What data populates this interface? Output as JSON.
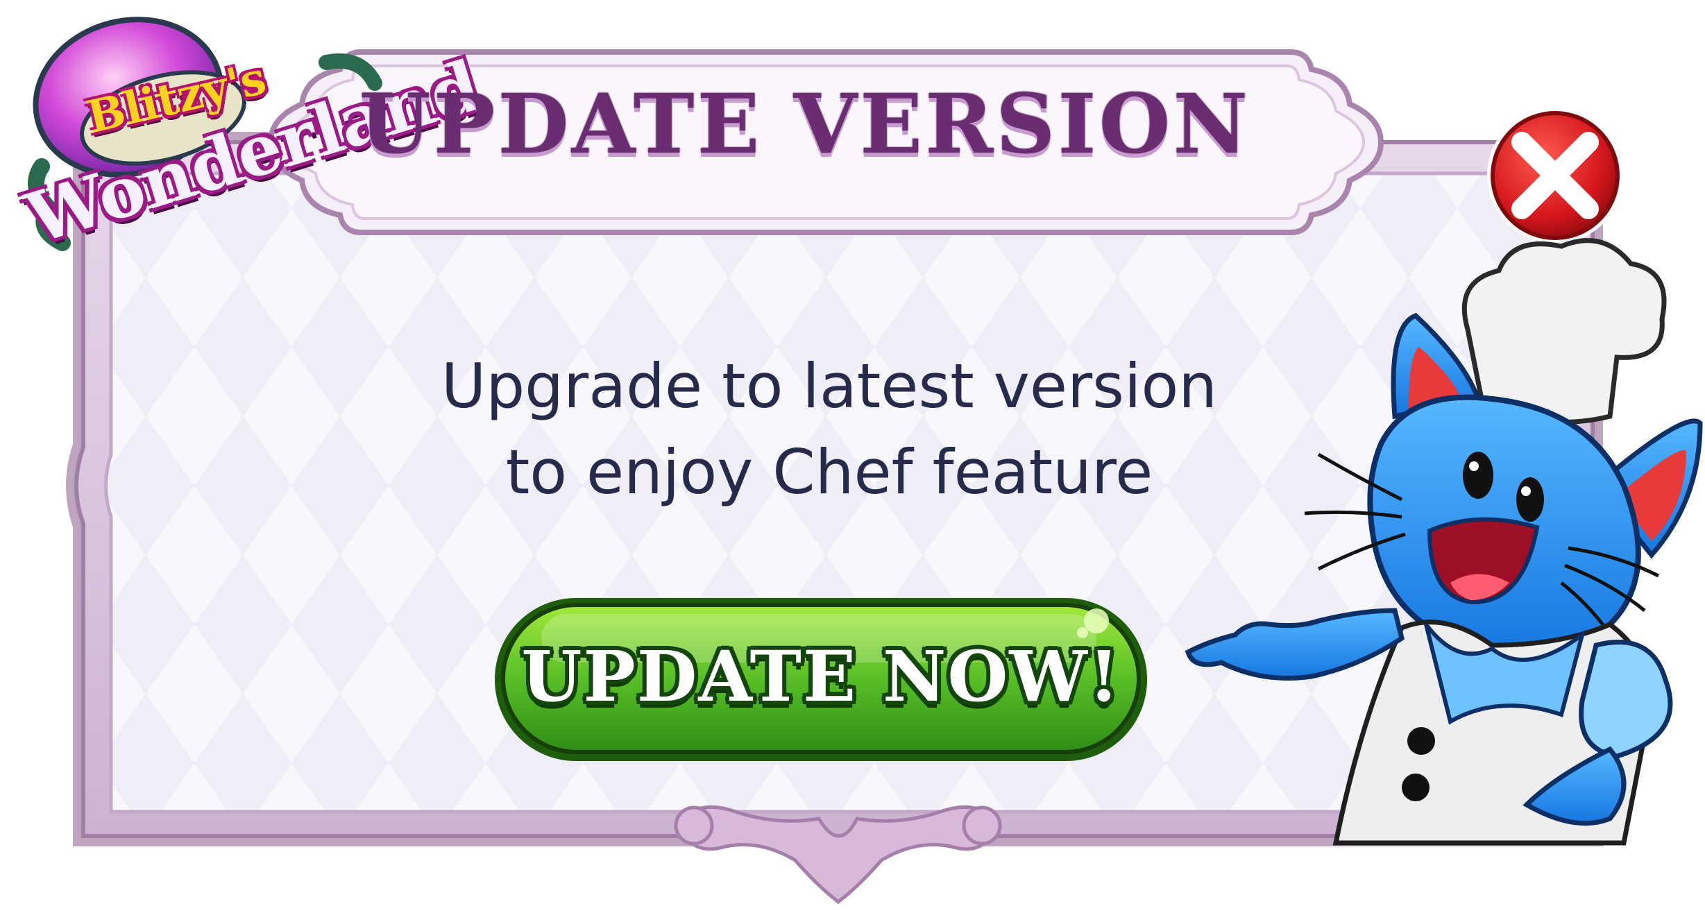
{
  "dialog": {
    "title": "UPDATE VERSION",
    "message_line1": "Upgrade to latest version",
    "message_line2": "to enjoy Chef feature",
    "primary_button_label": "UPDATE NOW!",
    "close_icon": "close-x-icon"
  },
  "logo": {
    "line1": "Blitzy's",
    "line2": "Wonderland"
  },
  "character": {
    "icon": "blue-cat-chef-mascot"
  },
  "colors": {
    "frame": "#d8c3dc",
    "panel": "#f8f6fb",
    "title_text": "#6a2d72",
    "message_text": "#272a4a",
    "button_green": "#4fba2a",
    "close_red": "#d0161b"
  }
}
